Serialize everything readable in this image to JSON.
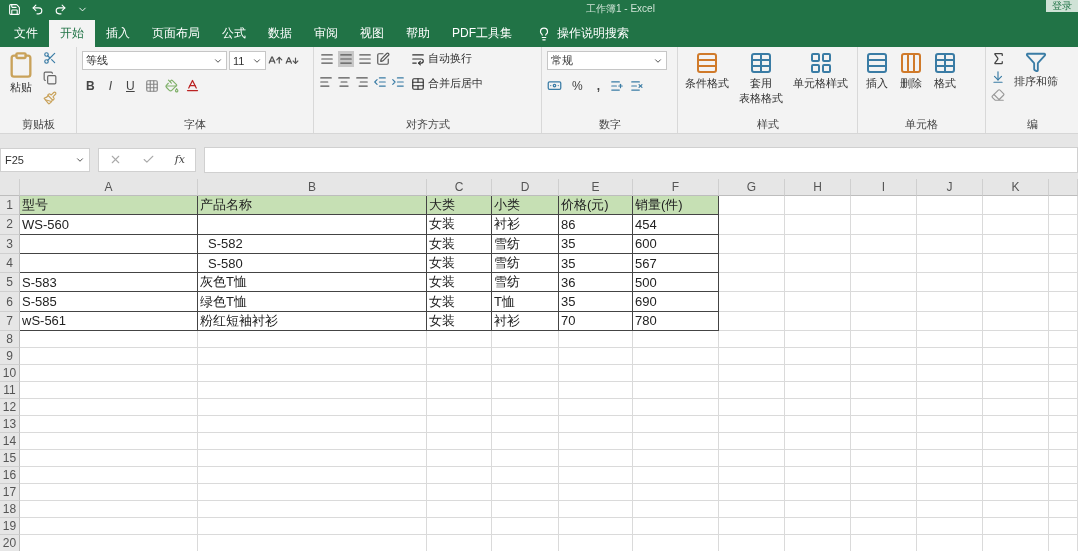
{
  "title_bar": {
    "title": "工作簿1 - Excel",
    "account_button": "登录"
  },
  "tabs": [
    {
      "label": "文件",
      "selected": false
    },
    {
      "label": "开始",
      "selected": true
    },
    {
      "label": "插入",
      "selected": false
    },
    {
      "label": "页面布局",
      "selected": false
    },
    {
      "label": "公式",
      "selected": false
    },
    {
      "label": "数据",
      "selected": false
    },
    {
      "label": "审阅",
      "selected": false
    },
    {
      "label": "视图",
      "selected": false
    },
    {
      "label": "帮助",
      "selected": false
    },
    {
      "label": "PDF工具集",
      "selected": false
    }
  ],
  "search_hint": "操作说明搜索",
  "ribbon": {
    "clipboard": {
      "paste": "粘贴",
      "label": "剪贴板"
    },
    "font": {
      "name": "等线",
      "size": "11",
      "bold": "B",
      "italic": "I",
      "underline": "U",
      "label": "字体"
    },
    "alignment": {
      "vertical": [
        {
          "selected": false
        },
        {
          "selected": true
        },
        {
          "selected": false
        }
      ],
      "wrap": "自动换行",
      "merge": "合并后居中",
      "label": "对齐方式"
    },
    "number": {
      "format": "常规",
      "percent": "%",
      "comma": ",",
      "label": "数字"
    },
    "styles": {
      "buttons": [
        {
          "lines": [
            "条件格式"
          ]
        },
        {
          "lines": [
            "套用",
            "表格格式"
          ]
        },
        {
          "lines": [
            "单元格样式"
          ]
        }
      ],
      "label": "样式"
    },
    "cells": {
      "buttons": [
        {
          "lines": [
            "插入"
          ]
        },
        {
          "lines": [
            "删除"
          ]
        },
        {
          "lines": [
            "格式"
          ]
        }
      ],
      "label": "单元格"
    },
    "editing": {
      "sort": "排序和筛",
      "label": "编"
    }
  },
  "formula_bar": {
    "name_box": "F25",
    "fx": "fx"
  },
  "sheet": {
    "columns": [
      "A",
      "B",
      "C",
      "D",
      "E",
      "F",
      "G",
      "H",
      "I",
      "J",
      "K"
    ],
    "rows": [
      {
        "number": "1",
        "kind": "header",
        "cells": [
          {
            "text": "型号"
          },
          {
            "text": "产品名称"
          },
          {
            "text": "大类"
          },
          {
            "text": "小类"
          },
          {
            "text": "价格(元)"
          },
          {
            "text": "销量(件)"
          }
        ]
      },
      {
        "number": "2",
        "kind": "data",
        "cells": [
          {
            "text": "WS-560"
          },
          null,
          {
            "text": "女装"
          },
          {
            "text": "衬衫"
          },
          {
            "text": "86"
          },
          {
            "text": "454"
          }
        ]
      },
      {
        "number": "3",
        "kind": "data",
        "cells": [
          null,
          {
            "text": "S-582",
            "indent": true
          },
          {
            "text": "女装"
          },
          {
            "text": "雪纺"
          },
          {
            "text": "35"
          },
          {
            "text": "600"
          }
        ]
      },
      {
        "number": "4",
        "kind": "data",
        "cells": [
          null,
          {
            "text": "S-580",
            "indent": true
          },
          {
            "text": "女装"
          },
          {
            "text": "雪纺"
          },
          {
            "text": "35"
          },
          {
            "text": "567"
          }
        ]
      },
      {
        "number": "5",
        "kind": "data",
        "cells": [
          {
            "text": "S-583"
          },
          {
            "text": "灰色T恤"
          },
          {
            "text": "女装"
          },
          {
            "text": "雪纺"
          },
          {
            "text": "36"
          },
          {
            "text": "500"
          }
        ]
      },
      {
        "number": "6",
        "kind": "data",
        "cells": [
          {
            "text": "S-585"
          },
          {
            "text": "绿色T恤"
          },
          {
            "text": "女装"
          },
          {
            "text": "T恤"
          },
          {
            "text": "35"
          },
          {
            "text": "690"
          }
        ]
      },
      {
        "number": "7",
        "kind": "data",
        "cells": [
          {
            "text": "wS-561"
          },
          {
            "text": "粉红短袖衬衫"
          },
          {
            "text": "女装"
          },
          {
            "text": "衬衫"
          },
          {
            "text": "70"
          },
          {
            "text": "780"
          }
        ]
      },
      {
        "number": "8",
        "kind": "empty"
      },
      {
        "number": "9",
        "kind": "empty"
      },
      {
        "number": "10",
        "kind": "empty"
      },
      {
        "number": "11",
        "kind": "empty"
      },
      {
        "number": "12",
        "kind": "empty"
      },
      {
        "number": "13",
        "kind": "empty"
      },
      {
        "number": "14",
        "kind": "empty"
      },
      {
        "number": "15",
        "kind": "empty"
      },
      {
        "number": "16",
        "kind": "empty"
      },
      {
        "number": "17",
        "kind": "empty"
      },
      {
        "number": "18",
        "kind": "empty"
      },
      {
        "number": "19",
        "kind": "empty"
      },
      {
        "number": "20",
        "kind": "empty"
      }
    ]
  }
}
